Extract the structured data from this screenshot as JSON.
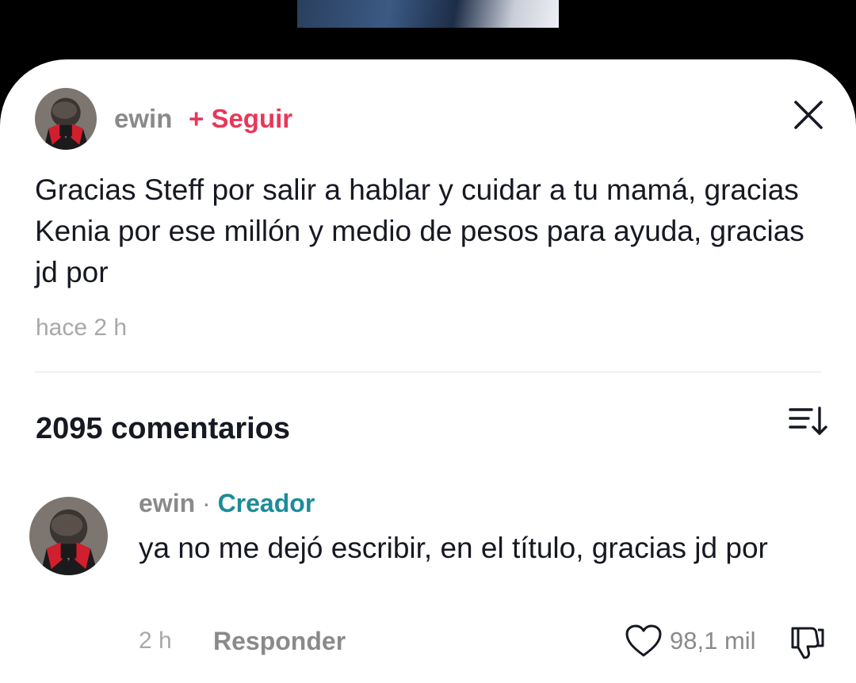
{
  "post": {
    "author": "ewin",
    "follow_label": "+ Seguir",
    "caption": "Gracias Steff por salir a hablar y cuidar a tu mamá, gracias Kenia por ese millón y medio de pesos para ayuda, gracias jd por",
    "timestamp": "hace 2 h"
  },
  "comments_header": {
    "count_label": "2095 comentarios"
  },
  "comment": {
    "author": "ewin",
    "separator": "·",
    "badge": "Creador",
    "text": "ya no me dejó escribir, en el título, gracias jd por",
    "time": "2 h",
    "reply_label": "Responder",
    "likes": "98,1 mil"
  },
  "icons": {
    "close": "close-icon",
    "sort": "sort-icon",
    "like": "heart-outline-icon",
    "dislike": "thumbs-down-icon"
  },
  "colors": {
    "follow": "#e8375a",
    "creator_badge": "#1c8c98"
  }
}
